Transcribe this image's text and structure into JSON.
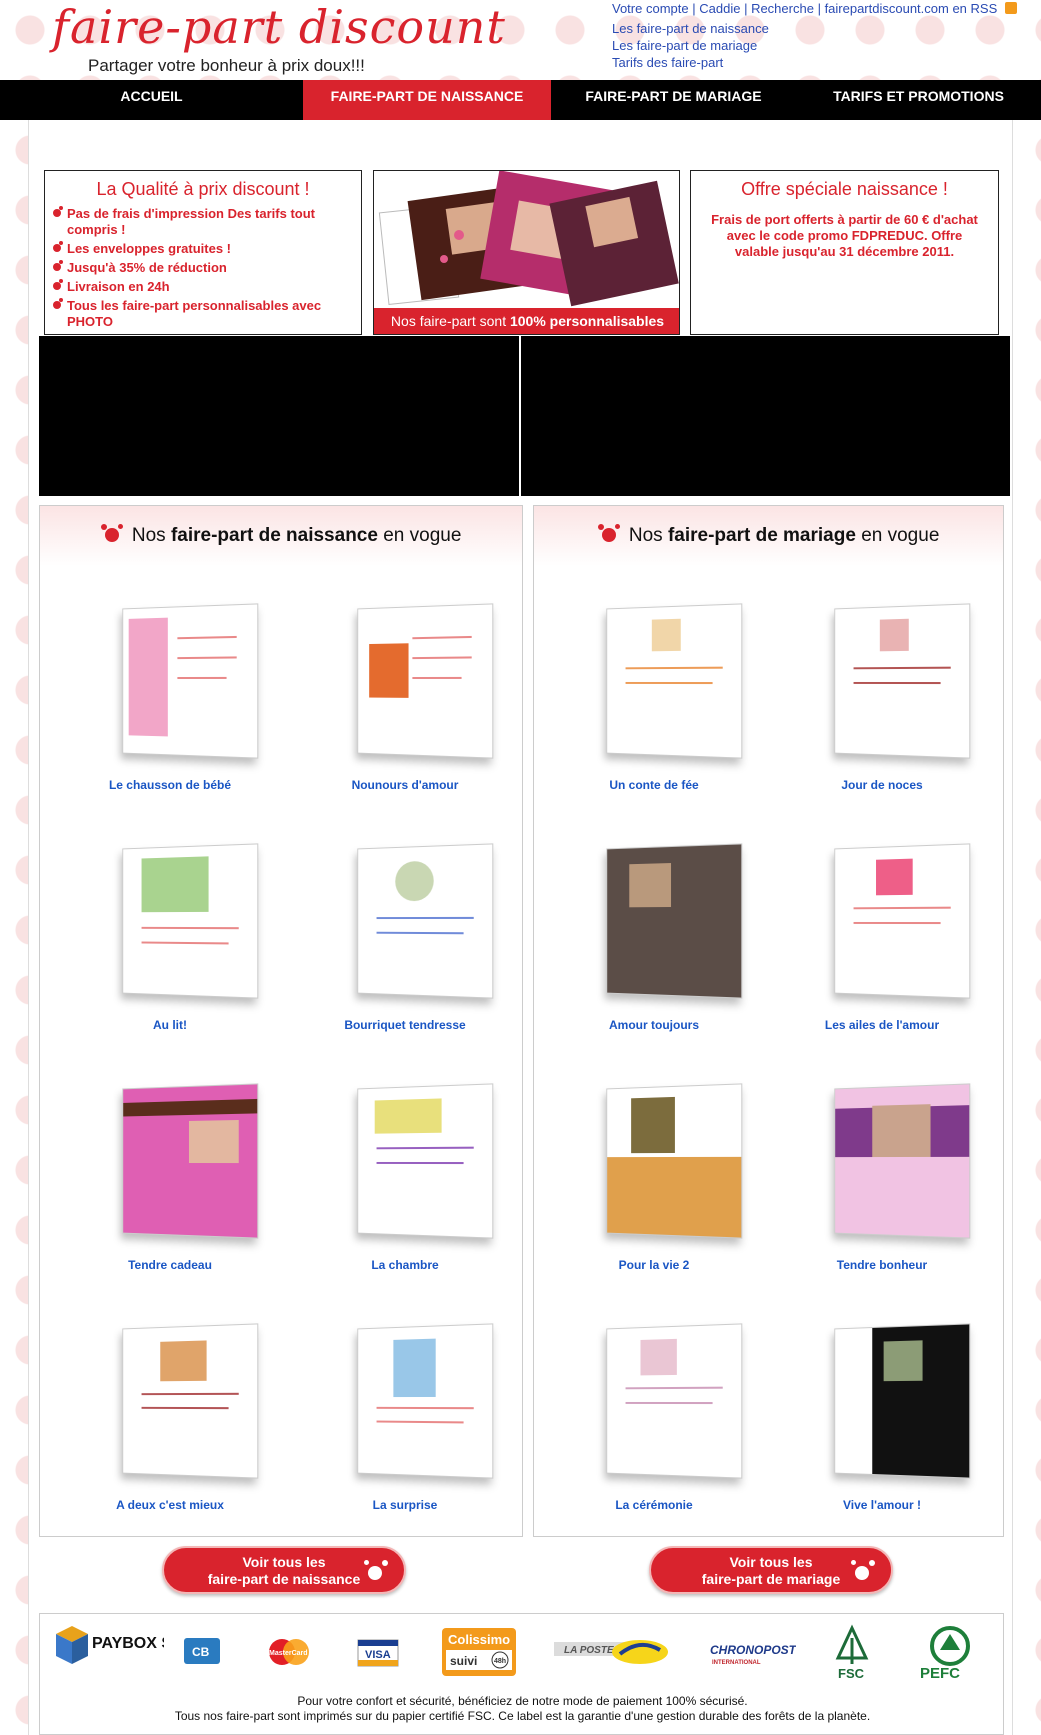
{
  "header": {
    "logo_text": "faire-part discount",
    "tagline": "Partager votre bonheur à prix doux!!!",
    "top_links": [
      "Votre compte",
      "Caddie",
      "Recherche",
      "fairepartdiscount.com en RSS"
    ],
    "sub_links": [
      "Les faire-part de naissance",
      "Les faire-part de mariage",
      "Tarifs des faire-part"
    ]
  },
  "nav": {
    "items": [
      "ACCUEIL",
      "FAIRE-PART DE NAISSANCE",
      "FAIRE-PART DE MARIAGE",
      "TARIFS ET PROMOTIONS"
    ],
    "active_index": 1
  },
  "quality_box": {
    "title": "La Qualité à prix discount !",
    "items": [
      "Pas de frais d'impression Des tarifs tout compris !",
      "Les enveloppes gratuites !",
      "Jusqu'à 35% de réduction",
      "Livraison en 24h",
      "Tous les faire-part personnalisables avec PHOTO"
    ]
  },
  "image_box": {
    "banner_prefix": "Nos faire-part sont ",
    "banner_bold": "100% personnalisables"
  },
  "offer_box": {
    "title": "Offre spéciale naissance !",
    "text": "Frais de port offerts à partir de 60 € d'achat avec le code promo FDPREDUC. Offre valable jusqu'au 31 décembre 2011."
  },
  "naissance_panel": {
    "title_prefix": "Nos ",
    "title_bold": "faire-part de naissance",
    "title_suffix": " en vogue",
    "products": [
      "Le chausson de bébé",
      "Nounours d'amour",
      "Au lit!",
      "Bourriquet tendresse",
      "Tendre cadeau",
      "La chambre",
      "A deux c'est mieux",
      "La surprise"
    ]
  },
  "mariage_panel": {
    "title_prefix": "Nos ",
    "title_bold": "faire-part de mariage",
    "title_suffix": " en vogue",
    "products": [
      "Un conte de fée",
      "Jour de noces",
      "Amour toujours",
      "Les ailes de l'amour",
      "Pour la vie 2",
      "Tendre bonheur",
      "La cérémonie",
      "Vive l'amour !"
    ]
  },
  "buttons": {
    "naissance": [
      "Voir tous les",
      "faire-part de naissance"
    ],
    "mariage": [
      "Voir tous les",
      "faire-part de mariage"
    ]
  },
  "footer": {
    "logos": [
      "PAYBOX SERVICES",
      "CB",
      "MasterCard",
      "VISA",
      "Colissimo",
      "suivi",
      "48h",
      "LA POSTE",
      "CHRONOPOST",
      "INTERNATIONAL",
      "FSC",
      "PEFC"
    ],
    "line1": "Pour votre confort et sécurité, bénéficiez de notre mode de paiement 100% sécurisé.",
    "line2": "Tous nos faire-part sont imprimés sur du papier certifié FSC. Ce label est la garantie d'une gestion durable des forêts de la planète."
  },
  "colors": {
    "accent": "#d9232d",
    "link": "#1a56c4",
    "nav_bg": "#000000"
  }
}
